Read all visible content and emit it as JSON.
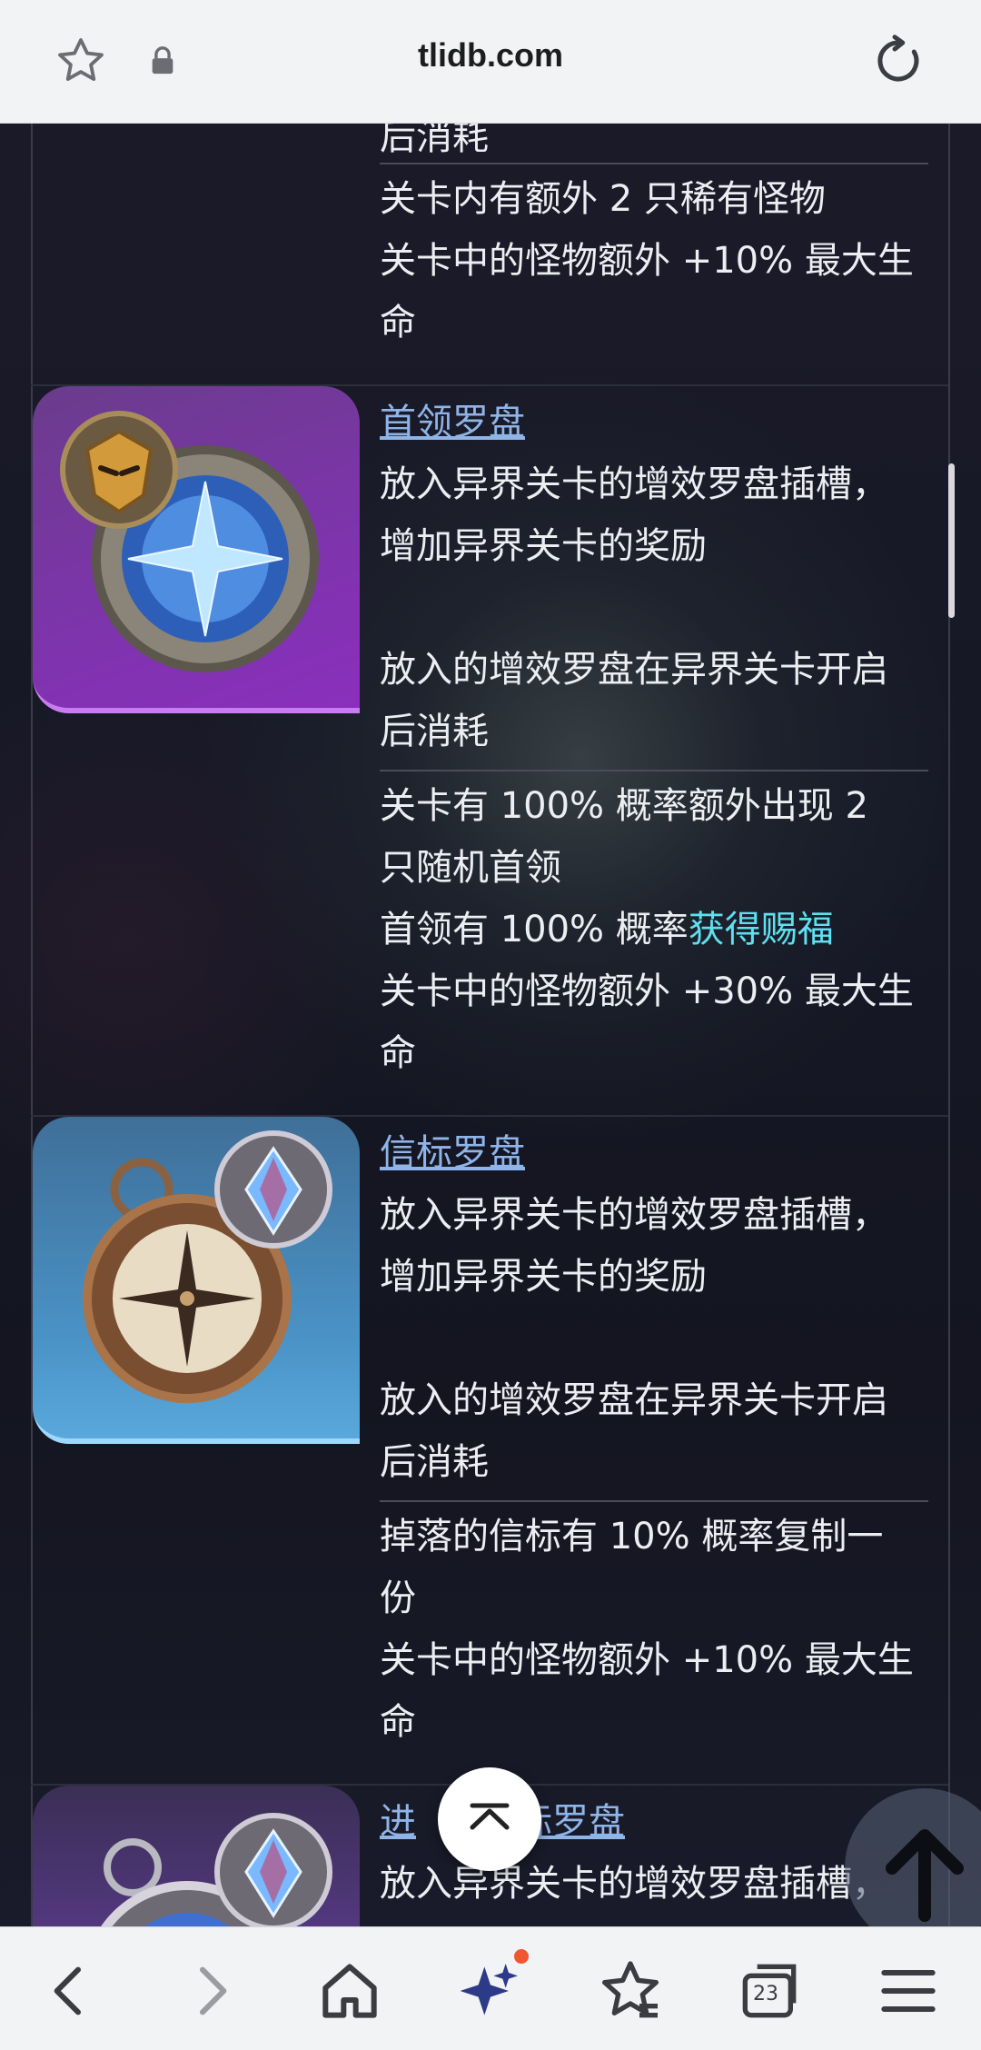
{
  "browser": {
    "url": "tlidb.com",
    "notification_dot_color": "#f0562f",
    "icons": [
      "star-icon",
      "lock-icon",
      "reload-icon"
    ]
  },
  "top_fragment": {
    "line0": "后消耗",
    "stats": [
      "关卡内有额外 2 只稀有怪物",
      "关卡中的怪物额外 +10% 最大生",
      "命"
    ]
  },
  "cards": [
    {
      "title": "首领罗盘",
      "desc": [
        "放入异界关卡的增效罗盘插槽，",
        "增加异界关卡的奖励",
        "放入的增效罗盘在异界关卡开启",
        "后消耗"
      ],
      "stats": [
        {
          "pre": "关卡有 100% 概率额外出现 2",
          "hl": ""
        },
        {
          "pre": "只随机首领",
          "hl": ""
        },
        {
          "pre": "首领有 100% 概率",
          "hl": "获得赐福"
        },
        {
          "pre": "关卡中的怪物额外 +30% 最大生",
          "hl": ""
        },
        {
          "pre": "命",
          "hl": ""
        }
      ]
    },
    {
      "title": "信标罗盘",
      "desc": [
        "放入异界关卡的增效罗盘插槽，",
        "增加异界关卡的奖励",
        "放入的增效罗盘在异界关卡开启",
        "后消耗"
      ],
      "stats": [
        {
          "pre": "掉落的信标有 10% 概率复制一",
          "hl": ""
        },
        {
          "pre": "份",
          "hl": ""
        },
        {
          "pre": "关卡中的怪物额外 +10% 最大生",
          "hl": ""
        },
        {
          "pre": "命",
          "hl": ""
        }
      ]
    },
    {
      "title_a": "进",
      "title_b": "标罗盘",
      "desc": [
        "放入异界关卡的增效罗盘插槽，"
      ]
    }
  ],
  "bottom_nav": [
    "back-icon",
    "forward-icon",
    "home-icon",
    "sparkle-icon",
    "favorites-icon",
    "tabs-icon",
    "menu-icon"
  ],
  "tabs_count": "23"
}
